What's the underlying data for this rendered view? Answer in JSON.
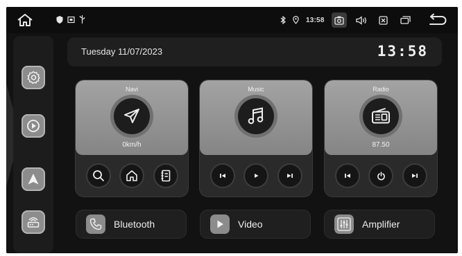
{
  "status_bar": {
    "time": "13:58",
    "left_icons": [
      "shield-icon",
      "sim-icon",
      "usb-icon"
    ],
    "right_icons": [
      "bluetooth-icon",
      "location-icon",
      "screenshot-icon",
      "volume-icon",
      "close-box-icon",
      "recent-apps-icon",
      "back-icon"
    ]
  },
  "sidebar": {
    "items": [
      {
        "name": "settings",
        "icon": "settings-icon"
      },
      {
        "name": "play",
        "icon": "play-icon"
      },
      {
        "name": "navigation",
        "icon": "navigation-arrow-icon"
      },
      {
        "name": "router",
        "icon": "router-icon"
      }
    ]
  },
  "header": {
    "date": "Tuesday 11/07/2023",
    "clock": "13:58"
  },
  "cards": {
    "navi": {
      "title": "Navi",
      "subtitle": "0km/h",
      "controls": [
        "search-icon",
        "home-icon",
        "book-icon"
      ]
    },
    "music": {
      "title": "Music",
      "controls": [
        "previous-icon",
        "play-icon",
        "next-icon"
      ]
    },
    "radio": {
      "title": "Radio",
      "frequency": "87.50",
      "controls": [
        "previous-icon",
        "power-icon",
        "next-icon"
      ]
    }
  },
  "bottom_bar": {
    "bluetooth": "Bluetooth",
    "video": "Video",
    "amplifier": "Amplifier"
  },
  "colors": {
    "background": "#121212",
    "card": "#2a2a2a",
    "accent_grey": "#8c8c8c"
  }
}
